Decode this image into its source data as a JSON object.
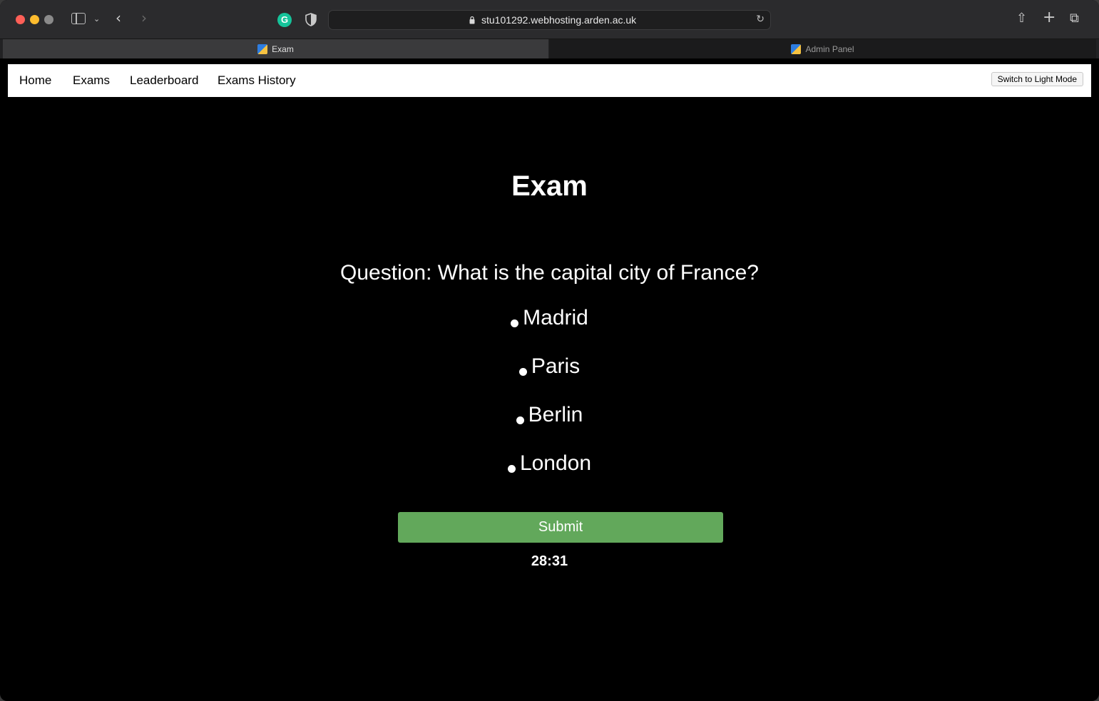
{
  "browser": {
    "url": "stu101292.webhosting.arden.ac.uk",
    "tabs": [
      {
        "label": "Exam",
        "active": true
      },
      {
        "label": "Admin Panel",
        "active": false
      }
    ]
  },
  "nav": {
    "items": [
      "Home",
      "Exams",
      "Leaderboard",
      "Exams History"
    ],
    "mode_toggle": "Switch to Light Mode"
  },
  "exam": {
    "title": "Exam",
    "question": "Question: What is the capital city of France?",
    "options": [
      "Madrid",
      "Paris",
      "Berlin",
      "London"
    ],
    "submit_label": "Submit",
    "timer": "28:31"
  },
  "colors": {
    "submit_bg": "#62a85b",
    "page_bg": "#000000",
    "navbar_bg": "#ffffff"
  }
}
